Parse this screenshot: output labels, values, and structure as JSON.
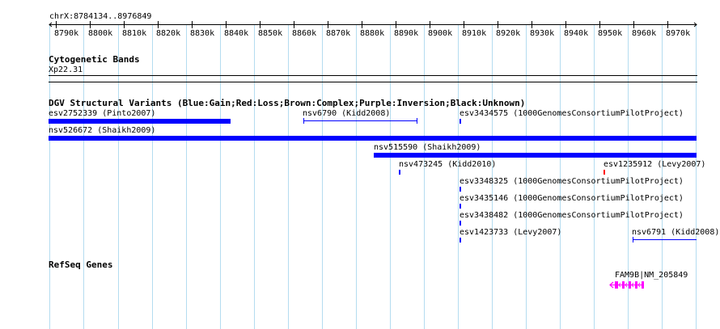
{
  "ruler": {
    "region": "chrX:8784134..8976849",
    "ticks": [
      "8790k",
      "8800k",
      "8810k",
      "8820k",
      "8830k",
      "8840k",
      "8850k",
      "8860k",
      "8870k",
      "8880k",
      "8890k",
      "8900k",
      "8910k",
      "8920k",
      "8930k",
      "8940k",
      "8950k",
      "8960k",
      "8970k"
    ]
  },
  "cytoband": {
    "title": "Cytogenetic Bands",
    "band": "Xp22.31"
  },
  "dgv": {
    "title": "DGV Structural Variants (Blue:Gain;Red:Loss;Brown:Complex;Purple:Inversion;Black:Unknown)",
    "colors": {
      "gain": "#0000ff",
      "loss": "#ff0000"
    },
    "features": [
      {
        "label": "esv2752339 (Pinto2007)"
      },
      {
        "label": "nsv6790 (Kidd2008)"
      },
      {
        "label": "esv3434575 (1000GenomesConsortiumPilotProject)"
      },
      {
        "label": "nsv526672 (Shaikh2009)"
      },
      {
        "label": "nsv515590 (Shaikh2009)"
      },
      {
        "label": "nsv473245 (Kidd2010)"
      },
      {
        "label": "esv1235912 (Levy2007)"
      },
      {
        "label": "esv3348325 (1000GenomesConsortiumPilotProject)"
      },
      {
        "label": "esv3435146 (1000GenomesConsortiumPilotProject)"
      },
      {
        "label": "esv3438482 (1000GenomesConsortiumPilotProject)"
      },
      {
        "label": "esv1423733 (Levy2007)"
      },
      {
        "label": "nsv6791 (Kidd2008)"
      }
    ]
  },
  "refseq": {
    "title": "RefSeq Genes",
    "gene_label": "FAM9B|NM_205849",
    "color": "#ff00ff"
  }
}
